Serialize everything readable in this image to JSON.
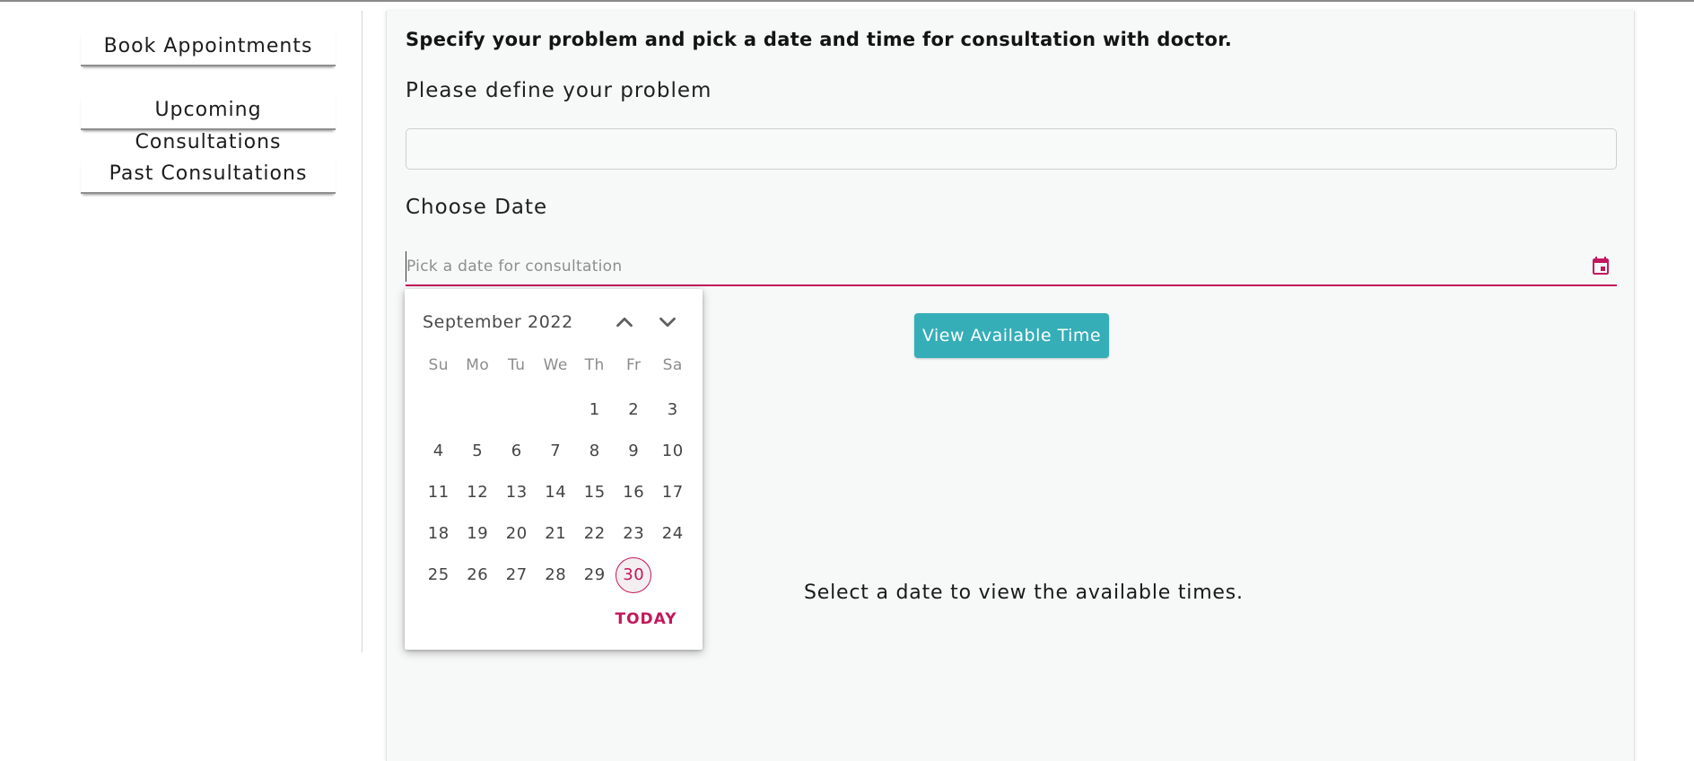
{
  "sidebar": {
    "items": [
      {
        "label": "Book Appointments"
      },
      {
        "label": "Upcoming Consultations"
      },
      {
        "label": "Past Consultations"
      }
    ]
  },
  "main": {
    "heading": "Specify your problem and pick a date and time for consultation with doctor.",
    "problem_label": "Please define your problem",
    "problem_value": "",
    "date_label": "Choose Date",
    "date_placeholder": "Pick a date for consultation",
    "date_icon": "calendar-icon",
    "view_button": "View Available Time",
    "hint": "Select a date to view the available times."
  },
  "datepicker": {
    "month": "September 2022",
    "prev_icon": "chevron-up-icon",
    "next_icon": "chevron-down-icon",
    "weekdays": [
      "Su",
      "Mo",
      "Tu",
      "We",
      "Th",
      "Fr",
      "Sa"
    ],
    "weeks": [
      [
        "",
        "",
        "",
        "",
        "1",
        "2",
        "3"
      ],
      [
        "4",
        "5",
        "6",
        "7",
        "8",
        "9",
        "10"
      ],
      [
        "11",
        "12",
        "13",
        "14",
        "15",
        "16",
        "17"
      ],
      [
        "18",
        "19",
        "20",
        "21",
        "22",
        "23",
        "24"
      ],
      [
        "25",
        "26",
        "27",
        "28",
        "29",
        "30",
        ""
      ]
    ],
    "today_day": "30",
    "today_button": "TODAY"
  },
  "colors": {
    "accent": "#c2185b",
    "button": "#35aeb8",
    "panel_bg": "#f7f8f8"
  }
}
